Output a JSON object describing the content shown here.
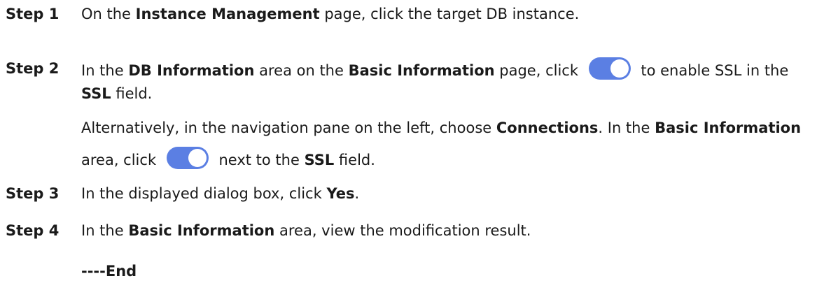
{
  "steps": [
    {
      "label": "Step 1",
      "parts": [
        "On the ",
        "Instance Management",
        " page, click the target DB instance."
      ]
    },
    {
      "label": "Step 2",
      "parts": [
        "In the ",
        "DB Information",
        " area on the ",
        "Basic Information",
        " page, click ",
        " to enable SSL in the ",
        "SSL",
        " field."
      ],
      "alt": [
        "Alternatively, in the navigation pane on the left, choose ",
        "Connections",
        ". In the ",
        "Basic Information",
        " area, click ",
        " next to the ",
        "SSL",
        " field."
      ]
    },
    {
      "label": "Step 3",
      "parts": [
        "In the displayed dialog box, click ",
        "Yes",
        "."
      ]
    },
    {
      "label": "Step 4",
      "parts": [
        "In the ",
        "Basic Information",
        " area, view the modification result."
      ]
    }
  ],
  "end_marker": "----End",
  "toggle": {
    "state": "on",
    "accent_color": "#5b7fe3",
    "icon": "toggle-switch-icon"
  }
}
